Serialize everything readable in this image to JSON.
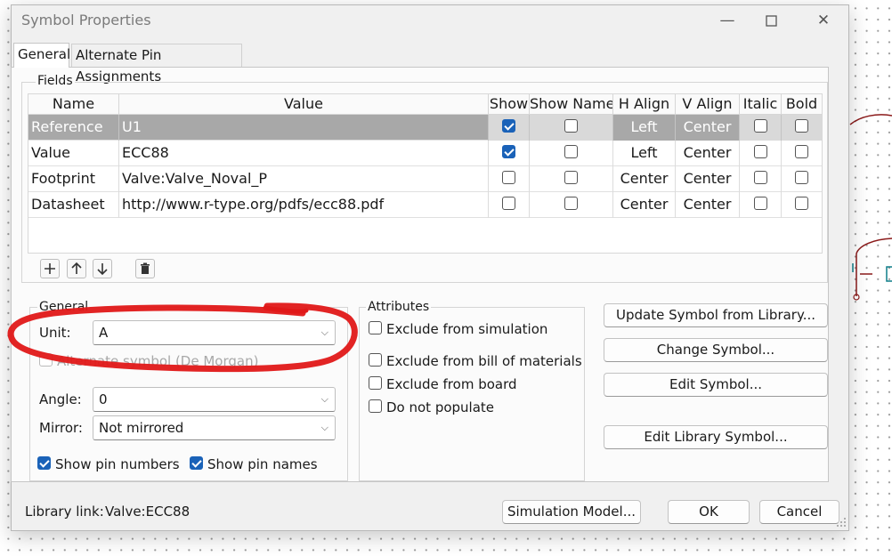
{
  "window": {
    "title": "Symbol Properties"
  },
  "tabs": [
    {
      "label": "General",
      "active": true
    },
    {
      "label": "Alternate Pin Assignments",
      "active": false
    }
  ],
  "fields": {
    "group_title": "Fields",
    "columns": [
      "Name",
      "Value",
      "Show",
      "Show Name",
      "H Align",
      "V Align",
      "Italic",
      "Bold"
    ],
    "rows": [
      {
        "name": "Reference",
        "value": "U1",
        "show": true,
        "show_name": false,
        "h_align": "Left",
        "v_align": "Center",
        "italic": false,
        "bold": false,
        "selected": true
      },
      {
        "name": "Value",
        "value": "ECC88",
        "show": true,
        "show_name": false,
        "h_align": "Left",
        "v_align": "Center",
        "italic": false,
        "bold": false,
        "selected": false
      },
      {
        "name": "Footprint",
        "value": "Valve:Valve_Noval_P",
        "show": false,
        "show_name": false,
        "h_align": "Center",
        "v_align": "Center",
        "italic": false,
        "bold": false,
        "selected": false
      },
      {
        "name": "Datasheet",
        "value": "http://www.r-type.org/pdfs/ecc88.pdf",
        "show": false,
        "show_name": false,
        "h_align": "Center",
        "v_align": "Center",
        "italic": false,
        "bold": false,
        "selected": false
      }
    ]
  },
  "general": {
    "group_title": "General",
    "unit_label": "Unit:",
    "unit_value": "A",
    "alternate_symbol_label": "Alternate symbol (De Morgan)",
    "alternate_symbol_checked": false,
    "angle_label": "Angle:",
    "angle_value": "0",
    "mirror_label": "Mirror:",
    "mirror_value": "Not mirrored",
    "show_pin_numbers_label": "Show pin numbers",
    "show_pin_numbers": true,
    "show_pin_names_label": "Show pin names",
    "show_pin_names": true
  },
  "attributes": {
    "group_title": "Attributes",
    "items": [
      {
        "label": "Exclude from simulation",
        "checked": false
      },
      {
        "label": "Exclude from bill of materials",
        "checked": false
      },
      {
        "label": "Exclude from board",
        "checked": false
      },
      {
        "label": "Do not populate",
        "checked": false
      }
    ]
  },
  "actions": {
    "update_symbol": "Update Symbol from Library...",
    "change_symbol": "Change Symbol...",
    "edit_symbol": "Edit Symbol...",
    "edit_library_symbol": "Edit Library Symbol..."
  },
  "footer": {
    "library_link_label": "Library link:",
    "library_link_value": "Valve:ECC88",
    "simulation_model": "Simulation Model...",
    "ok": "OK",
    "cancel": "Cancel"
  },
  "colors": {
    "accent": "#1a62b8",
    "selected_row": "#a8a8a8",
    "annotation_red": "#e01818",
    "schematic_wire": "#8b1a1a",
    "schematic_pin": "#0e7f8a"
  }
}
